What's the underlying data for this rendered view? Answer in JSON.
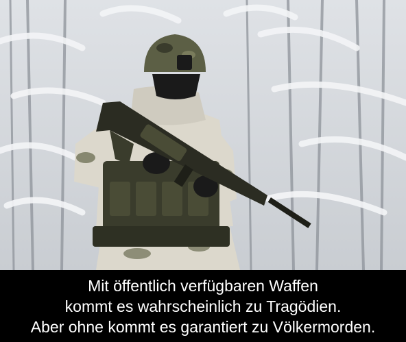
{
  "caption": {
    "line1": "Mit öffentlich verfügbaren Waffen",
    "line2": "kommt es wahrscheinlich zu Tragödien.",
    "line3": "Aber ohne kommt es garantiert zu Völkermorden."
  },
  "photo": {
    "subject": "soldier-with-rifle",
    "colors": {
      "snow": "#e9ebee",
      "tree": "#8e939a",
      "camo_green": "#5c5f45",
      "camo_snow": "#dcd8cc",
      "gear": "#3a3c2c",
      "black": "#1a1a1a"
    }
  }
}
